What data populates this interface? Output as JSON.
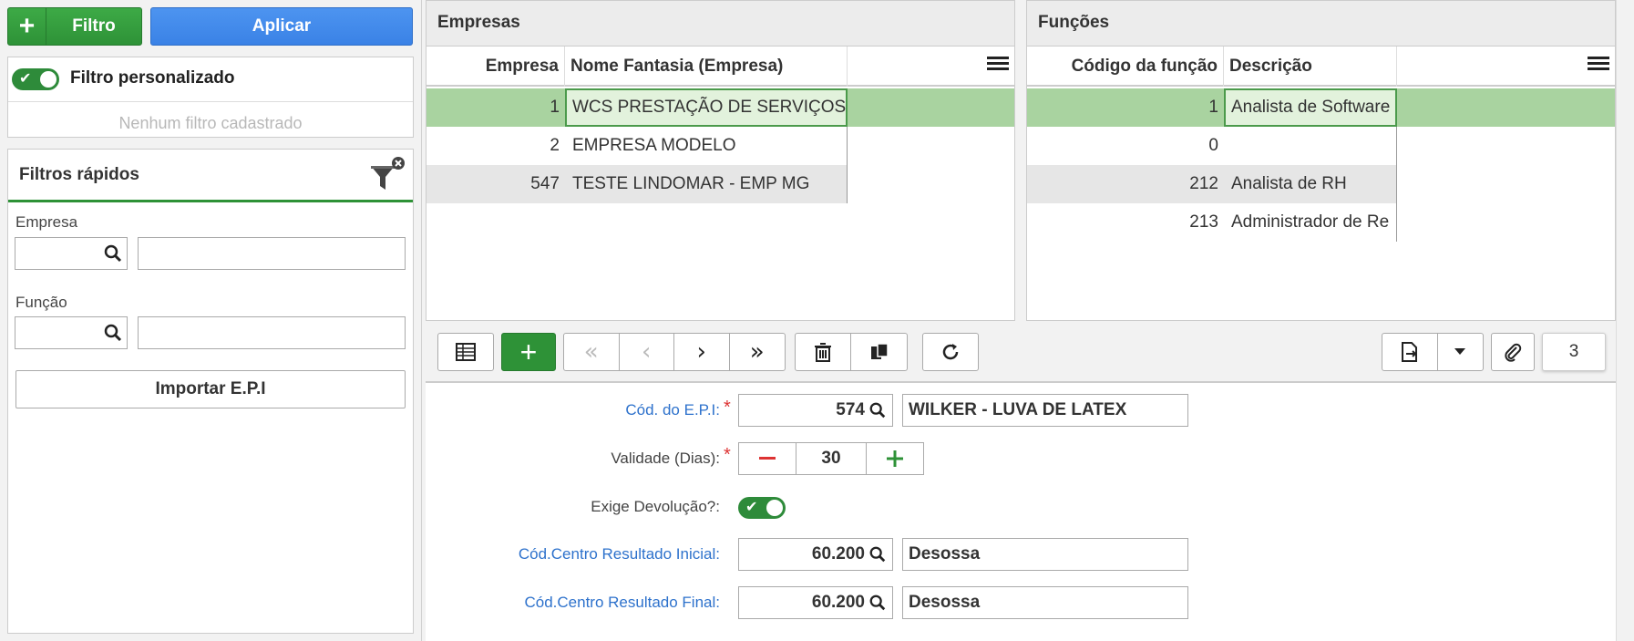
{
  "left": {
    "filter_button": "Filtro",
    "apply_button": "Aplicar",
    "custom_filter_label": "Filtro personalizado",
    "no_filter_text": "Nenhum filtro cadastrado",
    "quick_filters_title": "Filtros rápidos",
    "empresa_label": "Empresa",
    "funcao_label": "Função",
    "import_button": "Importar E.P.I"
  },
  "empresas": {
    "title": "Empresas",
    "columns": [
      "Empresa",
      "Nome Fantasia (Empresa)"
    ],
    "rows": [
      {
        "code": "1",
        "name": "WCS PRESTAÇÃO DE SERVIÇOS"
      },
      {
        "code": "2",
        "name": "EMPRESA MODELO"
      },
      {
        "code": "547",
        "name": "TESTE LINDOMAR - EMP MG"
      }
    ]
  },
  "funcoes": {
    "title": "Funções",
    "columns": [
      "Código da função",
      "Descrição"
    ],
    "rows": [
      {
        "code": "1",
        "name": "Analista de Software"
      },
      {
        "code": "0",
        "name": ""
      },
      {
        "code": "212",
        "name": "Analista de RH"
      },
      {
        "code": "213",
        "name": "Administrador de Re"
      }
    ]
  },
  "toolbar": {
    "attachment_count": "3"
  },
  "form": {
    "epi_label": "Cód. do E.P.I:",
    "epi_code": "574",
    "epi_desc": "WILKER - LUVA DE LATEX",
    "validade_label": "Validade (Dias):",
    "validade_value": "30",
    "devolucao_label": "Exige Devolução?:",
    "cr_inicial_label": "Cód.Centro Resultado Inicial:",
    "cr_inicial_code": "60.200",
    "cr_inicial_desc": "Desossa",
    "cr_final_label": "Cód.Centro Resultado Final:",
    "cr_final_code": "60.200",
    "cr_final_desc": "Desossa"
  },
  "colors": {
    "green": "#2e9237",
    "blue": "#3a82e6",
    "selected_row": "#a9d3a0",
    "link_label": "#2e72cc"
  }
}
